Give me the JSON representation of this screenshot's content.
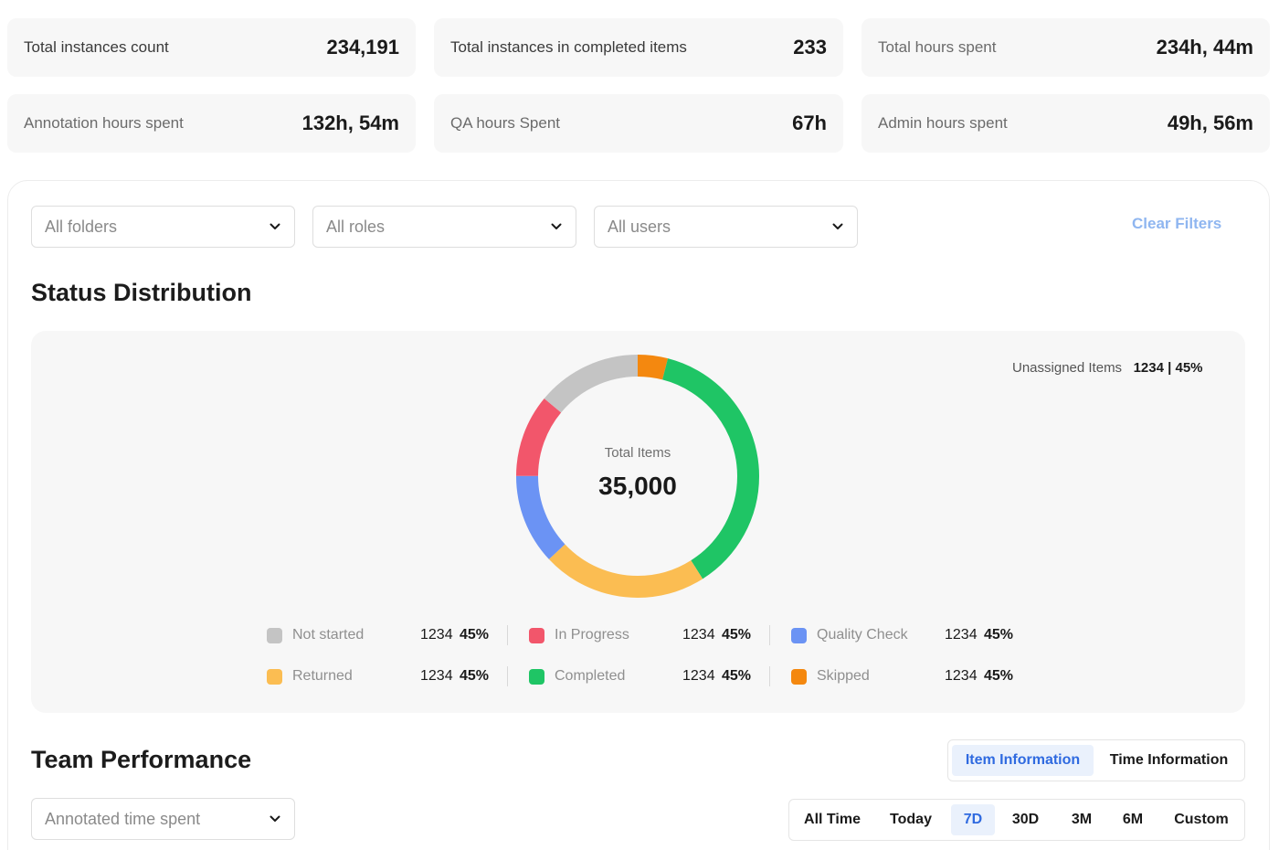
{
  "stats": [
    {
      "label": "Total instances count",
      "value": "234,191"
    },
    {
      "label": "Total instances in completed items",
      "value": "233"
    },
    {
      "label": "Total hours spent",
      "value": "234h, 44m"
    },
    {
      "label": "Annotation hours spent",
      "value": "132h, 54m"
    },
    {
      "label": "QA hours Spent",
      "value": "67h"
    },
    {
      "label": "Admin hours spent",
      "value": "49h, 56m"
    }
  ],
  "filters": {
    "folders": "All folders",
    "roles": "All roles",
    "users": "All users",
    "clear": "Clear Filters"
  },
  "status_distribution": {
    "title": "Status Distribution",
    "unassigned_label": "Unassigned Items",
    "unassigned_value": "1234 | 45%",
    "total_label": "Total Items",
    "total_value": "35,000",
    "legend": [
      {
        "name": "Not started",
        "count": "1234",
        "pct": "45%",
        "color": "#c4c4c4"
      },
      {
        "name": "In Progress",
        "count": "1234",
        "pct": "45%",
        "color": "#f2566b"
      },
      {
        "name": "Quality Check",
        "count": "1234",
        "pct": "45%",
        "color": "#6b93f4"
      },
      {
        "name": "Returned",
        "count": "1234",
        "pct": "45%",
        "color": "#fbbd52"
      },
      {
        "name": "Completed",
        "count": "1234",
        "pct": "45%",
        "color": "#1fc565"
      },
      {
        "name": "Skipped",
        "count": "1234",
        "pct": "45%",
        "color": "#f4880f"
      }
    ],
    "donut_segments": [
      {
        "status": "Skipped",
        "fraction": 0.04,
        "color": "#f4880f"
      },
      {
        "status": "Completed",
        "fraction": 0.37,
        "color": "#1fc565"
      },
      {
        "status": "Returned",
        "fraction": 0.22,
        "color": "#fbbd52"
      },
      {
        "status": "Quality Check",
        "fraction": 0.12,
        "color": "#6b93f4"
      },
      {
        "status": "In Progress",
        "fraction": 0.11,
        "color": "#f2566b"
      },
      {
        "status": "Not started",
        "fraction": 0.14,
        "color": "#c4c4c4"
      }
    ]
  },
  "team_performance": {
    "title": "Team Performance",
    "metric_select": "Annotated time spent",
    "tabs": [
      "Item Information",
      "Time Information"
    ],
    "active_tab": "Item Information",
    "ranges": [
      "All Time",
      "Today",
      "7D",
      "30D",
      "3M",
      "6M",
      "Custom"
    ],
    "active_range": "7D"
  }
}
